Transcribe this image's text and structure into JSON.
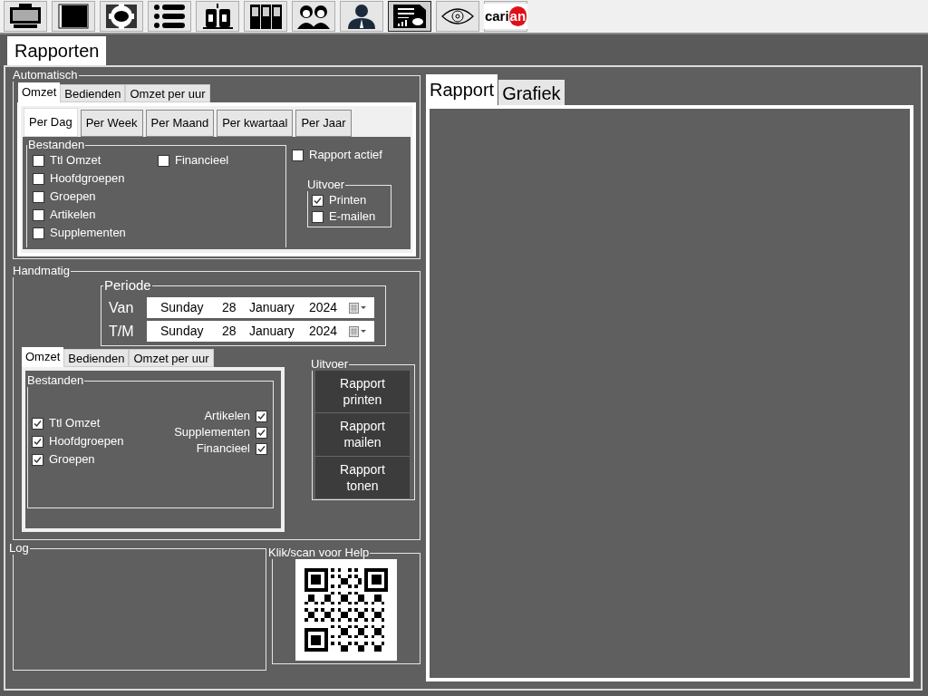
{
  "toolbar": {
    "buttons": [
      {
        "kind": "monitor",
        "selected": false
      },
      {
        "kind": "notebook",
        "selected": false
      },
      {
        "kind": "gear",
        "selected": false
      },
      {
        "kind": "list",
        "selected": false
      },
      {
        "kind": "shakers",
        "selected": false
      },
      {
        "kind": "binders",
        "selected": false
      },
      {
        "kind": "people",
        "selected": false
      },
      {
        "kind": "person",
        "selected": false
      },
      {
        "kind": "report",
        "selected": true
      },
      {
        "kind": "eye",
        "selected": false
      },
      {
        "kind": "logo",
        "selected": false,
        "logo_text": [
          "cari",
          "an"
        ]
      }
    ]
  },
  "main_tabs": [
    {
      "label": "Rapporten",
      "selected": true
    }
  ],
  "automatic": {
    "title": "Automatisch",
    "tabs": [
      {
        "label": "Omzet",
        "selected": true
      },
      {
        "label": "Bedienden",
        "selected": false
      },
      {
        "label": "Omzet per uur",
        "selected": false
      }
    ],
    "period_tabs": [
      {
        "label": "Per Dag",
        "selected": true
      },
      {
        "label": "Per Week",
        "selected": false
      },
      {
        "label": "Per Maand",
        "selected": false
      },
      {
        "label": "Per kwartaal",
        "selected": false
      },
      {
        "label": "Per Jaar",
        "selected": false
      }
    ],
    "files": {
      "title": "Bestanden",
      "columns": [
        [
          {
            "label": "Ttl Omzet",
            "checked": false
          },
          {
            "label": "Hoofdgroepen",
            "checked": false
          },
          {
            "label": "Groepen",
            "checked": false
          },
          {
            "label": "Artikelen",
            "checked": false
          },
          {
            "label": "Supplementen",
            "checked": false
          }
        ],
        [
          {
            "label": "Financieel",
            "checked": false
          }
        ]
      ]
    },
    "report_active": {
      "label": "Rapport actief",
      "checked": false
    },
    "output": {
      "title": "Uitvoer",
      "items": [
        {
          "label": "Printen",
          "checked": true
        },
        {
          "label": "E-mailen",
          "checked": false
        }
      ]
    }
  },
  "manual": {
    "title": "Handmatig",
    "period": {
      "title": "Periode",
      "rows": [
        {
          "label": "Van",
          "day": "Sunday",
          "date": "28",
          "month": "January",
          "year": "2024"
        },
        {
          "label": "T/M",
          "day": "Sunday",
          "date": "28",
          "month": "January",
          "year": "2024"
        }
      ]
    },
    "tabs": [
      {
        "label": "Omzet",
        "selected": true
      },
      {
        "label": "Bedienden",
        "selected": false
      },
      {
        "label": "Omzet per uur",
        "selected": false
      }
    ],
    "files": {
      "title": "Bestanden",
      "columns": [
        [
          {
            "label": "Ttl Omzet",
            "checked": true
          },
          {
            "label": "Hoofdgroepen",
            "checked": true
          },
          {
            "label": "Groepen",
            "checked": true
          }
        ],
        [
          {
            "label": "Artikelen",
            "checked": true
          },
          {
            "label": "Supplementen",
            "checked": true
          },
          {
            "label": "Financieel",
            "checked": true
          }
        ]
      ]
    },
    "output": {
      "title": "Uitvoer",
      "buttons": [
        [
          "Rapport",
          "printen"
        ],
        [
          "Rapport",
          "mailen"
        ],
        [
          "Rapport",
          "tonen"
        ]
      ]
    }
  },
  "log": {
    "title": "Log"
  },
  "help": {
    "title": "Klik/scan voor Help"
  },
  "report_tabs": [
    {
      "label": "Rapport",
      "selected": true
    },
    {
      "label": "Grafiek",
      "selected": false
    }
  ]
}
